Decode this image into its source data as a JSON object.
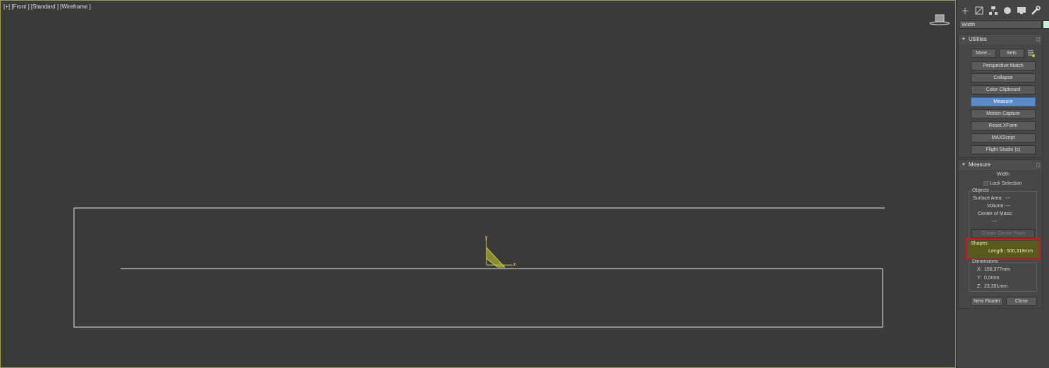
{
  "viewport": {
    "label": "[+] [Front ] [Standard ] [Wireframe ]",
    "axis_y_label": "y",
    "axis_x_label": "x"
  },
  "command_panel": {
    "tabs": [
      "create-icon",
      "modify-icon",
      "hierarchy-icon",
      "motion-icon",
      "display-icon",
      "utilities-icon"
    ],
    "object_name": "Width",
    "object_color": "#c8f0dc",
    "utilities": {
      "title": "Utilities",
      "more_label": "More...",
      "sets_label": "Sets",
      "buttons": [
        "Perspective Match",
        "Collapse",
        "Color Clipboard",
        "Measure",
        "Motion Capture",
        "Reset XForm",
        "MAXScript",
        "Flight Studio (c)"
      ],
      "active_button": "Measure"
    },
    "measure": {
      "title": "Measure",
      "object_name": "Width",
      "lock_selection_label": "Lock Selection",
      "lock_selection_checked": false,
      "objects_title": "Objects",
      "surface_area_label": "Surface Area:",
      "surface_area_value": "---",
      "volume_label": "Volume:",
      "volume_value": "---",
      "center_of_mass_label": "Center of Mass:",
      "center_of_mass_value": "---",
      "create_center_point_label": "Create Center Point",
      "shapes_title": "Shapes",
      "length_label": "Length:",
      "length_value": "500,318mm",
      "dimensions_title": "Dimensions",
      "x_label": "X:",
      "x_value": "158,377mm",
      "y_label": "Y:",
      "y_value": "0,0mm",
      "z_label": "Z:",
      "z_value": "23,391mm",
      "new_floater_label": "New Floater",
      "close_label": "Close"
    }
  },
  "colors": {
    "viewport_bg": "#3a3a3a",
    "wire": "#e6e6e6",
    "gizmo": "#c8c84a",
    "active_button": "#5a8ac8",
    "highlight": "#d01818"
  }
}
